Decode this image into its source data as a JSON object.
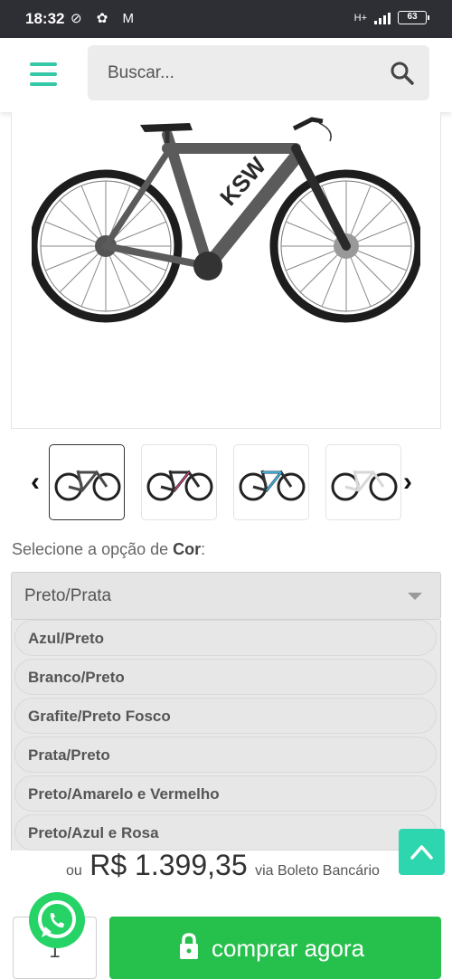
{
  "status_bar": {
    "time": "18:32",
    "battery": "63",
    "network": "H+"
  },
  "header": {
    "search_placeholder": "Buscar...",
    "menu_icon": "hamburger-menu-icon",
    "search_icon": "magnifier-icon"
  },
  "gallery": {
    "thumbnails": [
      {
        "label": "bike-graphite",
        "frame_color": "#4a4a4a",
        "accent": "#9a9a9a"
      },
      {
        "label": "bike-pink",
        "frame_color": "#2b2b2b",
        "accent": "#c2407a"
      },
      {
        "label": "bike-blue",
        "frame_color": "#2f2f2f",
        "accent": "#38a8d8"
      },
      {
        "label": "bike-white",
        "frame_color": "#e6e6e6",
        "accent": "#333333"
      }
    ]
  },
  "variant": {
    "prompt_prefix": "Selecione a opção de",
    "prompt_bold": "Cor",
    "prompt_suffix": ":",
    "selected": "Preto/Prata",
    "options": [
      "Azul/Preto",
      "Branco/Preto",
      "Grafite/Preto Fosco",
      "Prata/Preto",
      "Preto/Amarelo e Vermelho",
      "Preto/Azul e Rosa"
    ]
  },
  "price": {
    "prefix": "ou",
    "value": "R$ 1.399,35",
    "suffix": "via Boleto Bancário"
  },
  "purchase": {
    "quantity": "1",
    "buy_label": "comprar agora"
  },
  "colors": {
    "accent": "#35c8a6",
    "buy_button": "#26c04d",
    "whatsapp": "#25d366",
    "scroll_top": "#2ed6b0"
  }
}
